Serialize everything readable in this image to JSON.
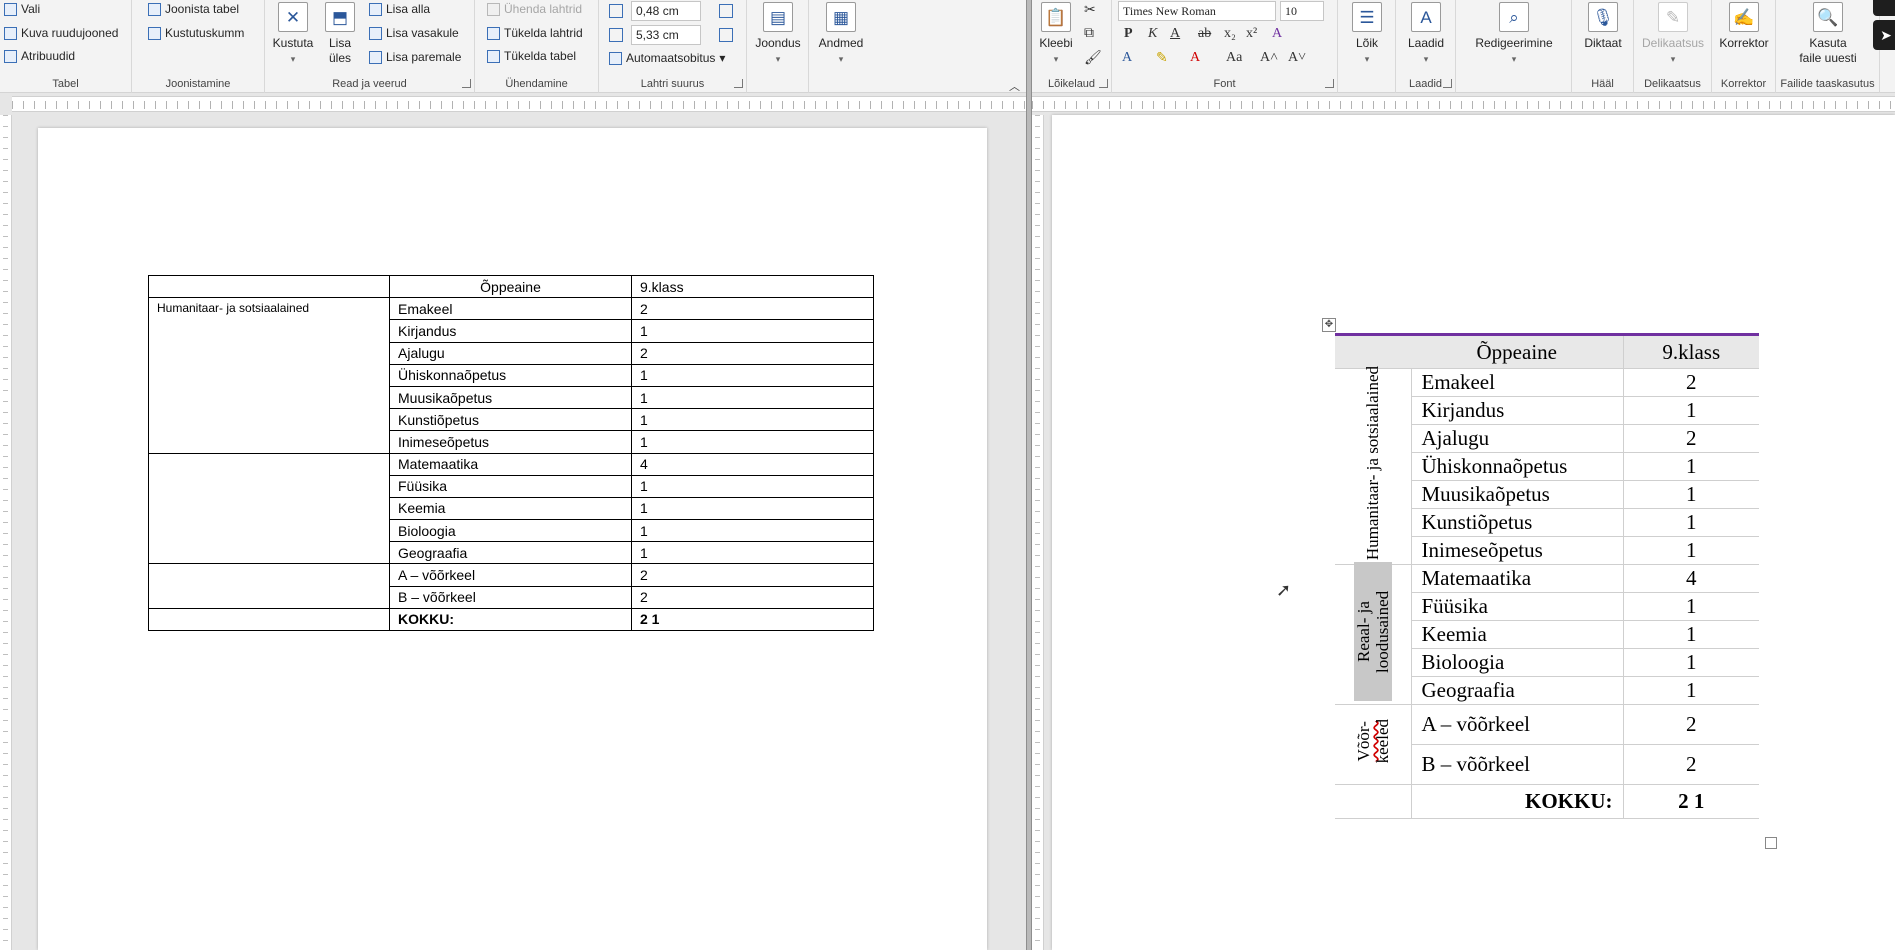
{
  "left": {
    "ribbon": {
      "table_group": {
        "label": "Tabel",
        "select": "Vali",
        "gridlines": "Kuva ruudujooned",
        "properties": "Atribuudid"
      },
      "draw_group": {
        "label": "Joonistamine",
        "draw_table": "Joonista tabel",
        "eraser": "Kustutuskumm"
      },
      "rows_group": {
        "label": "Read ja veerud",
        "delete": "Kustuta",
        "insert_above_1": "Lisa",
        "insert_above_2": "üles",
        "insert_below": "Lisa alla",
        "insert_left": "Lisa vasakule",
        "insert_right": "Lisa paremale"
      },
      "merge_group": {
        "label": "Ühendamine",
        "merge": "Ühenda lahtrid",
        "split_cells": "Tükelda lahtrid",
        "split_table": "Tükelda tabel"
      },
      "cellsize_group": {
        "label": "Lahtri suurus",
        "height": "0,48 cm",
        "width": "5,33 cm",
        "autofit": "Automaatsobitus"
      },
      "alignment": "Joondus",
      "data": "Andmed"
    },
    "table": {
      "header": {
        "subject": "Õppeaine",
        "grade": "9.klass"
      },
      "group1_label": "Humanitaar- ja sotsiaalained",
      "rows": [
        {
          "subject": "Emakeel",
          "value": "2"
        },
        {
          "subject": "Kirjandus",
          "value": "1"
        },
        {
          "subject": "Ajalugu",
          "value": "2"
        },
        {
          "subject": "Ühiskonnaõpetus",
          "value": "1"
        },
        {
          "subject": "Muusikaõpetus",
          "value": "1"
        },
        {
          "subject": "Kunstiõpetus",
          "value": "1"
        },
        {
          "subject": "Inimeseõpetus",
          "value": "1"
        },
        {
          "subject": "Matemaatika",
          "value": "4"
        },
        {
          "subject": "Füüsika",
          "value": "1"
        },
        {
          "subject": "Keemia",
          "value": "1"
        },
        {
          "subject": "Bioloogia",
          "value": "1"
        },
        {
          "subject": "Geograafia",
          "value": "1"
        },
        {
          "subject": "A – võõrkeel",
          "value": "2"
        },
        {
          "subject": "B – võõrkeel",
          "value": "2"
        }
      ],
      "total": {
        "label": "KOKKU:",
        "value": "2 1"
      }
    }
  },
  "right": {
    "ribbon": {
      "clipboard": {
        "label": "Lõikelaud",
        "paste": "Kleebi"
      },
      "font": {
        "label": "Font",
        "name": "Times New Roman",
        "size": "10"
      },
      "paragraph": "Lõik",
      "styles": {
        "label": "Laadid",
        "button": "Laadid"
      },
      "editing": "Redigeerimine",
      "voice": {
        "label": "Hääl",
        "dictate": "Diktaat"
      },
      "sensitivity": {
        "label": "Delikaatsus",
        "button": "Delikaatsus"
      },
      "editor": {
        "label": "Korrektor",
        "button": "Korrektor"
      },
      "reuse": {
        "label": "Failide taaskasutus",
        "line1": "Kasuta",
        "line2": "faile uuesti"
      }
    },
    "table": {
      "header": {
        "subject": "Õppeaine",
        "grade": "9.klass"
      },
      "group1": "Humanitaar- ja sotsiaalained",
      "group2": "Reaal- ja loodusained",
      "group3_a": "Võõr-",
      "group3_b": "keeled",
      "rows": [
        {
          "subject": "Emakeel",
          "value": "2"
        },
        {
          "subject": "Kirjandus",
          "value": "1"
        },
        {
          "subject": "Ajalugu",
          "value": "2"
        },
        {
          "subject": "Ühiskonnaõpetus",
          "value": "1"
        },
        {
          "subject": "Muusikaõpetus",
          "value": "1"
        },
        {
          "subject": "Kunstiõpetus",
          "value": "1"
        },
        {
          "subject": "Inimeseõpetus",
          "value": "1"
        },
        {
          "subject": "Matemaatika",
          "value": "4"
        },
        {
          "subject": "Füüsika",
          "value": "1"
        },
        {
          "subject": "Keemia",
          "value": "1"
        },
        {
          "subject": "Bioloogia",
          "value": "1"
        },
        {
          "subject": "Geograafia",
          "value": "1"
        },
        {
          "subject": "A – võõrkeel",
          "value": "2"
        },
        {
          "subject": "B – võõrkeel",
          "value": "2"
        }
      ],
      "total": {
        "label": "KOKKU:",
        "value": "2 1"
      }
    }
  },
  "colors": {
    "accent_border": "#7030a0",
    "ribbon_bg": "#f3f3f3",
    "word_blue": "#2b579a"
  }
}
